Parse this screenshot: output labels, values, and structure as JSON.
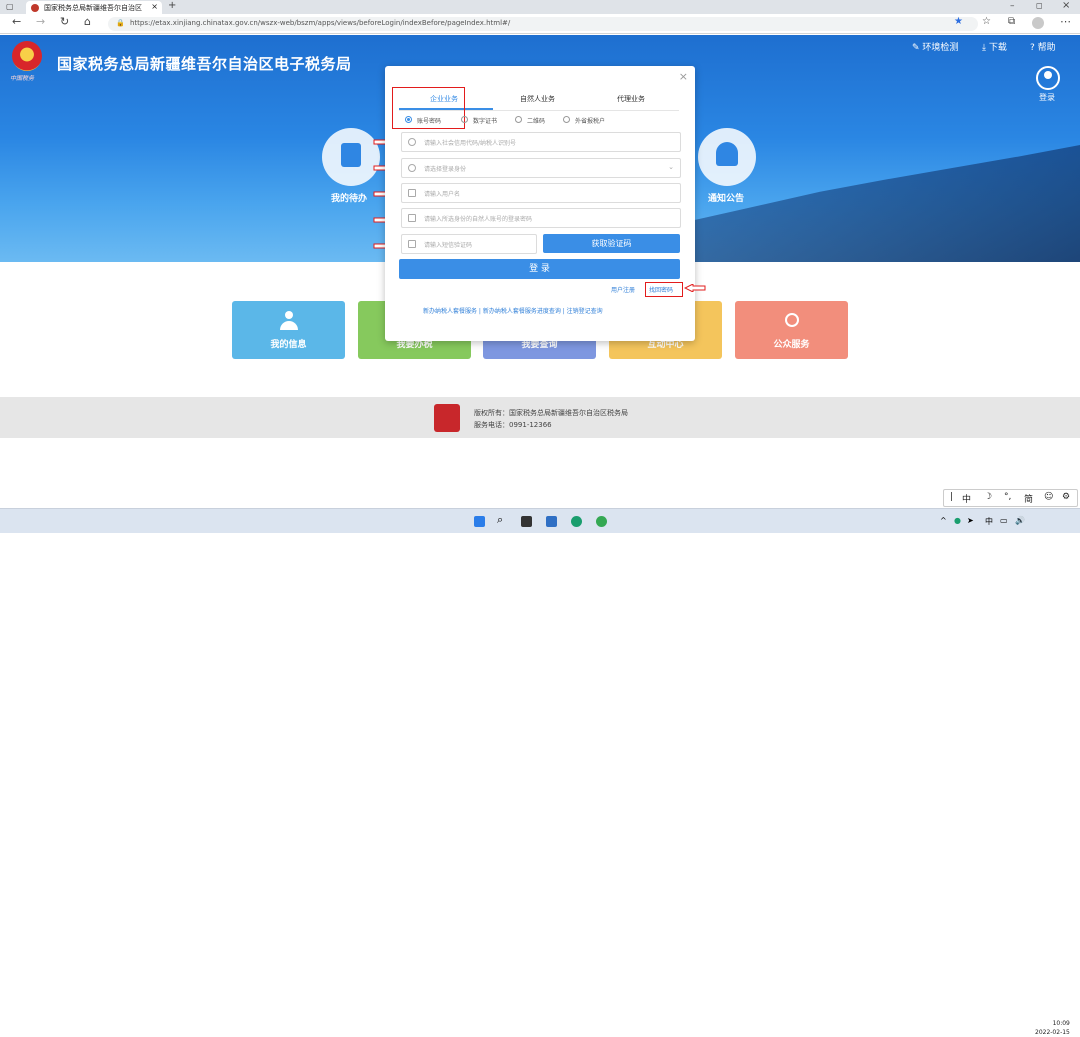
{
  "browser": {
    "tab_title": "国家税务总局新疆维吾尔自治区",
    "url": "https://etax.xinjiang.chinatax.gov.cn/wszx-web/bszm/apps/views/beforeLogin/indexBefore/pageIndex.html#/"
  },
  "header": {
    "site_title": "国家税务总局新疆维吾尔自治区电子税务局",
    "emblem_caption": "中国税务",
    "links": [
      "环境检测",
      "下载",
      "帮助"
    ],
    "login": "登录"
  },
  "banner": {
    "todo_label": "我的待办",
    "notice_label": "通知公告"
  },
  "tiles": [
    {
      "label": "我的信息",
      "color": "#5bb7e8"
    },
    {
      "label": "我要办税",
      "color": "#86c95d"
    },
    {
      "label": "我要查询",
      "color": "#7e97e0"
    },
    {
      "label": "互动中心",
      "color": "#f4c55c"
    },
    {
      "label": "公众服务",
      "color": "#f28e7c"
    }
  ],
  "footer": {
    "copyright": "版权所有：国家税务总局新疆维吾尔自治区税务局",
    "phone": "服务电话：0991-12366"
  },
  "modal": {
    "close": "×",
    "tabs": [
      "企业业务",
      "自然人业务",
      "代理业务"
    ],
    "login_methods": [
      "账号密码",
      "数字证书",
      "二维码",
      "外省报税户"
    ],
    "fields": {
      "credit_code": "请输入社会信用代码/纳税人识别号",
      "identity": "请选择登录身份",
      "username": "请输入用户名",
      "password": "请输入所选身份的自然人账号的登录密码",
      "sms_code": "请输入短信验证码"
    },
    "get_code_button": "获取验证码",
    "login_button": "登 录",
    "register_link": "用户注册",
    "forgot_link": "找回密码",
    "bottom_links": "新办纳税人套餐服务 | 新办纳税人套餐服务进度查询 | 注销登记查询"
  },
  "taskbar": {
    "ime": "中",
    "ime_mode": "简",
    "clock_time": "10:09",
    "clock_date": "2022-02-15"
  },
  "colors": {
    "primary": "#3a8ee6",
    "highlight_red": "#e21c1c"
  }
}
